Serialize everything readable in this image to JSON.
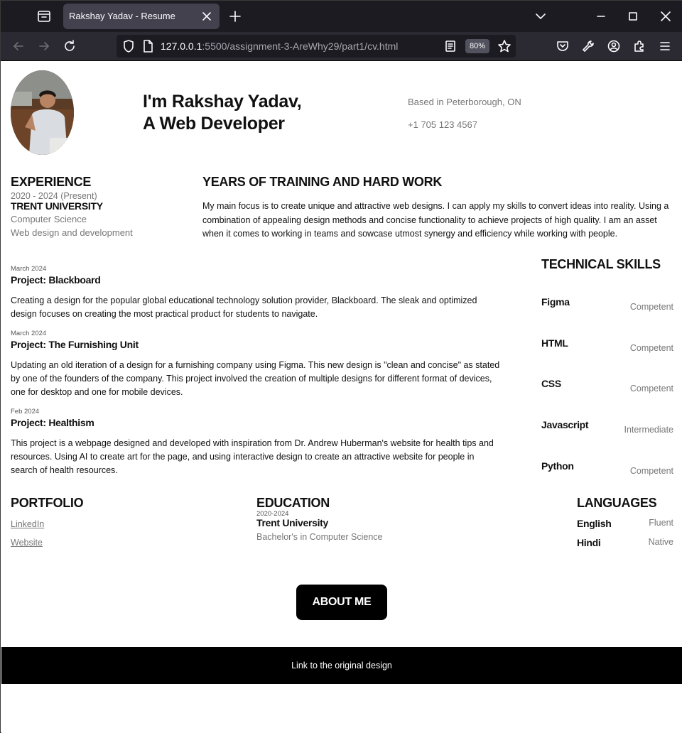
{
  "browser": {
    "tab_title": "Rakshay Yadav - Resume",
    "url_host": "127.0.0.1",
    "url_rest": ":5500/assignment-3-AreWhy29/part1/cv.html",
    "zoom": "80%"
  },
  "hero": {
    "title_line1": "I'm Rakshay Yadav,",
    "title_line2": "A Web Developer",
    "location": "Based in Peterborough, ON",
    "phone": "+1 705 123 4567"
  },
  "experience": {
    "heading": "EXPERIENCE",
    "dates": "2020 - 2024 (Present)",
    "school": "TRENT UNIVERSITY",
    "line1": "Computer Science",
    "line2": "Web design and development"
  },
  "years": {
    "heading": "YEARS OF TRAINING AND HARD WORK",
    "text": "My main focus is to create unique and attractive web designs. I can apply my skills to convert ideas into reality. Using a combination of appealing design methods and concise functionality to achieve projects of high quality. I am an asset when it comes to working in teams and sowcase utmost synergy and efficiency while working with people."
  },
  "projects": [
    {
      "date": "March 2024",
      "title": "Project: Blackboard",
      "desc": "Creating a design for the popular global educational technology solution provider, Blackboard. The sleak and optimized design focuses on creating the most practical product for students to navigate."
    },
    {
      "date": "March 2024",
      "title": "Project: The Furnishing Unit",
      "desc": "Updating an old iteration of a design for a furnishing company using Figma. This new design is \"clean and concise\" as stated by one of the founders of the company. This project involved the creation of multiple designs for different format of devices, one for desktop and one for mobile devices."
    },
    {
      "date": "Feb 2024",
      "title": "Project: Healthism",
      "desc": "This project is a webpage designed and developed with inspiration from Dr. Andrew Huberman's website for health tips and resources. Using AI to create art for the page, and using interactive design to create an attractive website for people in search of health resources."
    }
  ],
  "skills": {
    "heading": "TECHNICAL SKILLS",
    "items": [
      {
        "name": "Figma",
        "level": "Competent"
      },
      {
        "name": "HTML",
        "level": "Competent"
      },
      {
        "name": "CSS",
        "level": "Competent"
      },
      {
        "name": "Javascript",
        "level": "Intermediate"
      },
      {
        "name": "Python",
        "level": "Competent"
      }
    ]
  },
  "portfolio": {
    "heading": "PORTFOLIO",
    "links": [
      "LinkedIn",
      "Website"
    ]
  },
  "education": {
    "heading": "EDUCATION",
    "dates": "2020-2024",
    "school": "Trent University",
    "degree": "Bachelor's in Computer Science"
  },
  "languages": {
    "heading": "LANGUAGES",
    "items": [
      {
        "name": "English",
        "level": "Fluent"
      },
      {
        "name": "Hindi",
        "level": "Native"
      }
    ]
  },
  "about_button": "ABOUT ME",
  "footer_link": "Link to the original design"
}
